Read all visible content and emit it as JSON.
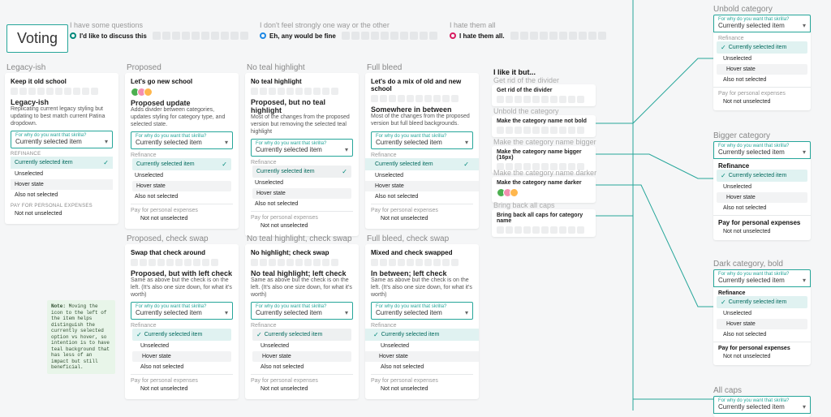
{
  "page_title": "Voting",
  "spectrum": [
    {
      "title": "I have some questions",
      "label": "I'd like to discuss this",
      "color": "teal"
    },
    {
      "title": "I don't feel strongly one way or the other",
      "label": "Eh, any would be fine",
      "color": "blue"
    },
    {
      "title": "I hate them all",
      "label": "I hate them all.",
      "color": "red"
    }
  ],
  "columns_row1": [
    "Legacy-ish",
    "Proposed",
    "No teal highlight",
    "Full bleed"
  ],
  "columns_row2": [
    "Proposed, check swap",
    "No teal highlight, check swap",
    "Full bleed, check swap"
  ],
  "cards": {
    "legacy": {
      "prompt": "Keep it old school",
      "name": "Legacy-ish",
      "desc": "Replicating current legacy styling but updating to best match current Patina dropdown."
    },
    "proposed": {
      "prompt": "Let's go new school",
      "name": "Proposed update",
      "desc": "Adds divider between categories, updates styling for category type, and selected state."
    },
    "noteal": {
      "prompt": "No teal highlight",
      "name": "Proposed, but no teal highlight",
      "desc": "Most of the changes from the proposed version but removing the selected teal highlight"
    },
    "fullbleed": {
      "prompt": "Let's do a mix of old and new school",
      "name": "Somewhere in between",
      "desc": "Most of the changes from the proposed version but full bleed backgrounds."
    },
    "proposed_swap": {
      "prompt": "Swap that check around",
      "name": "Proposed, but with left check",
      "desc": "Same as above but the check is on the left. (It's also one size down, for what it's worth)"
    },
    "noteal_swap": {
      "prompt": "No highlight; check swap",
      "name": "No teal highlight; left check",
      "desc": "Same as above but the check is on the left. (It's also one size down, for what it's worth)"
    },
    "fullbleed_swap": {
      "prompt": "Mixed and check swapped",
      "name": "In between; left check",
      "desc": "Same as above but the check is on the left. (It's also one size down, for what it's worth)"
    }
  },
  "dropdown": {
    "field_label": "For why do you want that skrilla?",
    "value": "Currently selected item",
    "cat1": "Refinance",
    "cat2": "Pay for personal expenses",
    "opt_selected": "Currently selected item",
    "opt_unselected": "Unselected",
    "opt_hover": "Hover state",
    "opt_notsel": "Also not selected",
    "opt_nested": "Not not unselected"
  },
  "note_label": "Note:",
  "note_body": "Moving the icon to the left of the item helps distinguish the currently selected option vs hover, so intention is to have teal background that has less of an impact but still beneficial.",
  "ilike": {
    "heading": "I like it but...",
    "groups": [
      {
        "sub": "Get rid of the divider",
        "title": "Get rid of the divider"
      },
      {
        "sub": "Unbold the category",
        "title": "Make the category name not bold"
      },
      {
        "sub": "Make the category name bigger",
        "title": "Make the category name bigger (16px)"
      },
      {
        "sub": "Make the category name darker",
        "title": "Make the category name darker"
      },
      {
        "sub": "Bring back all caps",
        "title": "Bring back all caps for category name"
      }
    ]
  },
  "right_heads": [
    "Unbold category",
    "Bigger category",
    "Dark category, bold",
    "All caps"
  ]
}
